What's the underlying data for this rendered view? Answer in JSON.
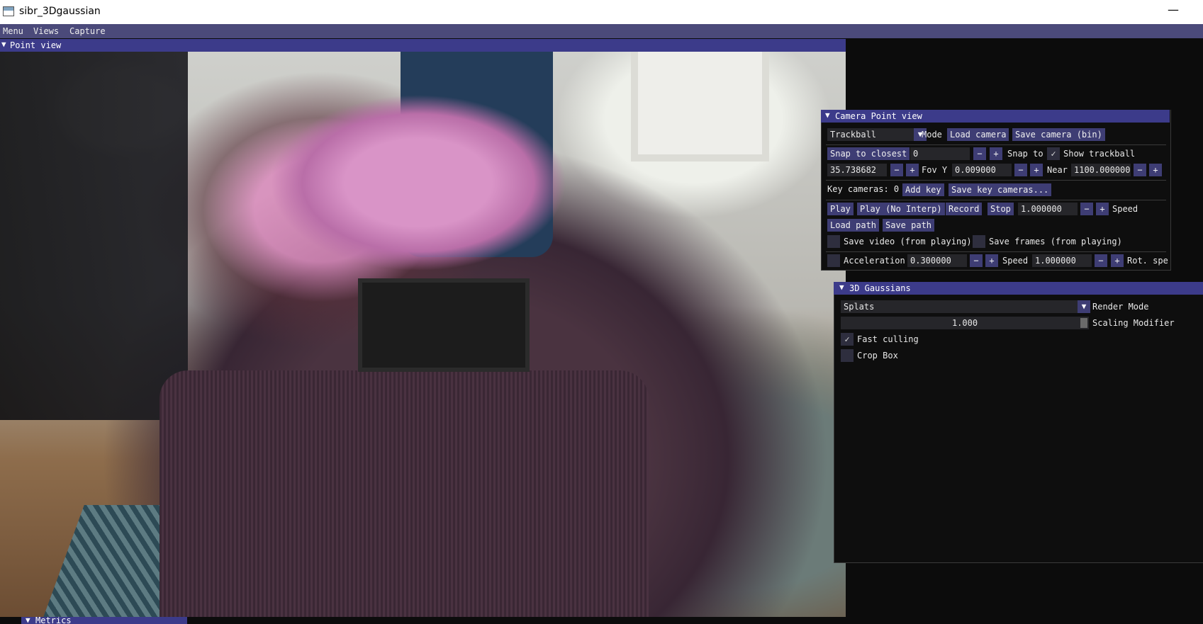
{
  "window": {
    "title": "sibr_3Dgaussian",
    "minimize_label": "—"
  },
  "menubar": {
    "items": [
      "Menu",
      "Views",
      "Capture"
    ]
  },
  "point_view": {
    "title": "Point view",
    "arrow": "▼"
  },
  "camera_panel": {
    "title": "Camera Point view",
    "arrow": "▼",
    "mode_value": "Trackball",
    "mode_label": "Mode",
    "load_camera": "Load camera",
    "save_camera": "Save camera (bin)",
    "snap_to_closest": "Snap to closest",
    "snap_value": "0",
    "snap_to_label": "Snap to",
    "show_trackball_label": "Show trackball",
    "show_trackball_checked": "✓",
    "fov_value": "35.738682",
    "fov_label": "Fov Y",
    "near_value": "0.009000",
    "near_label": "Near",
    "far_value": "1100.000000",
    "minus": "−",
    "plus": "+",
    "key_cameras_label": "Key cameras: 0",
    "add_key": "Add key",
    "save_key_cameras": "Save key cameras...",
    "play": "Play",
    "play_no_interp": "Play (No Interp)",
    "record": "Record",
    "stop": "Stop",
    "speed_value": "1.000000",
    "speed_label": "Speed",
    "load_path": "Load path",
    "save_path": "Save path",
    "save_video_label": "Save video (from playing)",
    "save_frames_label": "Save frames (from playing)",
    "acceleration_label": "Acceleration",
    "acceleration_value": "0.300000",
    "speed2_label": "Speed",
    "speed2_value": "1.000000",
    "rot_speed_label": "Rot. spe"
  },
  "gaussians_panel": {
    "title": "3D Gaussians",
    "arrow": "▼",
    "render_mode_value": "Splats",
    "render_mode_label": "Render Mode",
    "scaling_value": "1.000",
    "scaling_label": "Scaling Modifier",
    "fast_culling_label": "Fast culling",
    "fast_culling_checked": "✓",
    "crop_box_label": "Crop Box"
  },
  "metrics_tab": {
    "title": "Metrics",
    "arrow": "▼"
  }
}
